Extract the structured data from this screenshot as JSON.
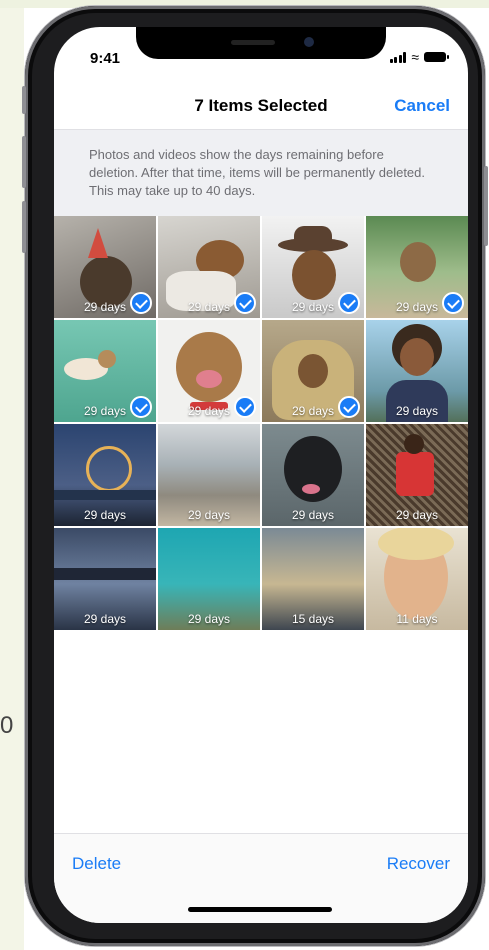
{
  "status_bar": {
    "time": "9:41"
  },
  "nav": {
    "title": "7 Items Selected",
    "cancel_label": "Cancel"
  },
  "info": {
    "text": "Photos and videos show the days remaining before deletion. After that time, items will be permanently deleted. This may take up to 40 days."
  },
  "photos": [
    {
      "label": "29 days",
      "selected": true
    },
    {
      "label": "29 days",
      "selected": true
    },
    {
      "label": "29 days",
      "selected": true
    },
    {
      "label": "29 days",
      "selected": true
    },
    {
      "label": "29 days",
      "selected": true
    },
    {
      "label": "29 days",
      "selected": true
    },
    {
      "label": "29 days",
      "selected": true
    },
    {
      "label": "29 days",
      "selected": false
    },
    {
      "label": "29 days",
      "selected": false
    },
    {
      "label": "29 days",
      "selected": false
    },
    {
      "label": "29 days",
      "selected": false
    },
    {
      "label": "29 days",
      "selected": false
    },
    {
      "label": "29 days",
      "selected": false
    },
    {
      "label": "29 days",
      "selected": false
    },
    {
      "label": "15 days",
      "selected": false
    },
    {
      "label": "11 days",
      "selected": false
    }
  ],
  "toolbar": {
    "delete_label": "Delete",
    "recover_label": "Recover"
  },
  "page": {
    "stray_text": "0"
  },
  "colors": {
    "accent": "#1a7cf6",
    "info_bg": "#eff0f3"
  }
}
